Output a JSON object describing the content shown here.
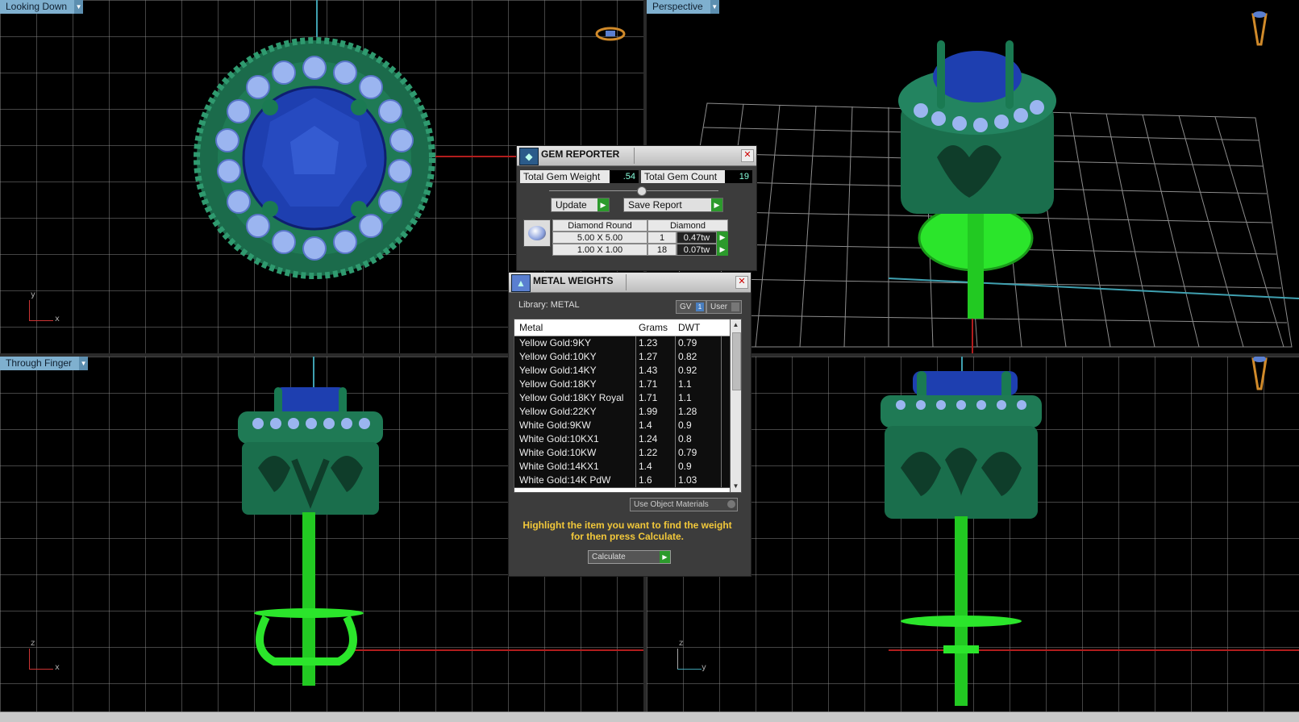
{
  "viewports": {
    "top_left": {
      "label": "Looking Down",
      "axis_x": "x",
      "axis_y": "y"
    },
    "top_right": {
      "label": "Perspective"
    },
    "bottom_left": {
      "label": "Through Finger",
      "axis_x": "x",
      "axis_y": "z"
    },
    "bottom_right": {
      "axis_x": "y",
      "axis_y": "z"
    }
  },
  "gem_reporter": {
    "title": "GEM REPORTER",
    "total_weight_label": "Total Gem Weight",
    "total_weight_value": ".54",
    "total_count_label": "Total Gem Count",
    "total_count_value": "19",
    "update_label": "Update",
    "save_report_label": "Save Report",
    "table": {
      "shape": "Diamond Round",
      "material": "Diamond",
      "rows": [
        {
          "size": "5.00 X 5.00",
          "count": "1",
          "weight": "0.47tw"
        },
        {
          "size": "1.00 X 1.00",
          "count": "18",
          "weight": "0.07tw"
        }
      ]
    }
  },
  "metal_weights": {
    "title": "METAL WEIGHTS",
    "library_label": "Library: METAL",
    "gv_label": "GV",
    "gv_indicator": "1",
    "user_label": "User",
    "columns": [
      "Metal",
      "Grams",
      "DWT"
    ],
    "rows": [
      {
        "metal": "Yellow Gold:9KY",
        "grams": "1.23",
        "dwt": "0.79"
      },
      {
        "metal": "Yellow Gold:10KY",
        "grams": "1.27",
        "dwt": "0.82"
      },
      {
        "metal": "Yellow Gold:14KY",
        "grams": "1.43",
        "dwt": "0.92"
      },
      {
        "metal": "Yellow Gold:18KY",
        "grams": "1.71",
        "dwt": "1.1"
      },
      {
        "metal": "Yellow Gold:18KY Royal",
        "grams": "1.71",
        "dwt": "1.1"
      },
      {
        "metal": "Yellow Gold:22KY",
        "grams": "1.99",
        "dwt": "1.28"
      },
      {
        "metal": "White Gold:9KW",
        "grams": "1.4",
        "dwt": "0.9"
      },
      {
        "metal": "White Gold:10KX1",
        "grams": "1.24",
        "dwt": "0.8"
      },
      {
        "metal": "White Gold:10KW",
        "grams": "1.22",
        "dwt": "0.79"
      },
      {
        "metal": "White Gold:14KX1",
        "grams": "1.4",
        "dwt": "0.9"
      },
      {
        "metal": "White Gold:14K PdW",
        "grams": "1.6",
        "dwt": "1.03"
      }
    ],
    "use_object_materials_label": "Use Object Materials",
    "hint": "Highlight the item you want to find the weight for then press Calculate.",
    "calculate_label": "Calculate"
  },
  "colors": {
    "grid": "#969696",
    "metal_green": "#1f7a55",
    "bright_green": "#33e633",
    "sapphire": "#1f3fa8",
    "accent_label": "#7fb0cf"
  }
}
